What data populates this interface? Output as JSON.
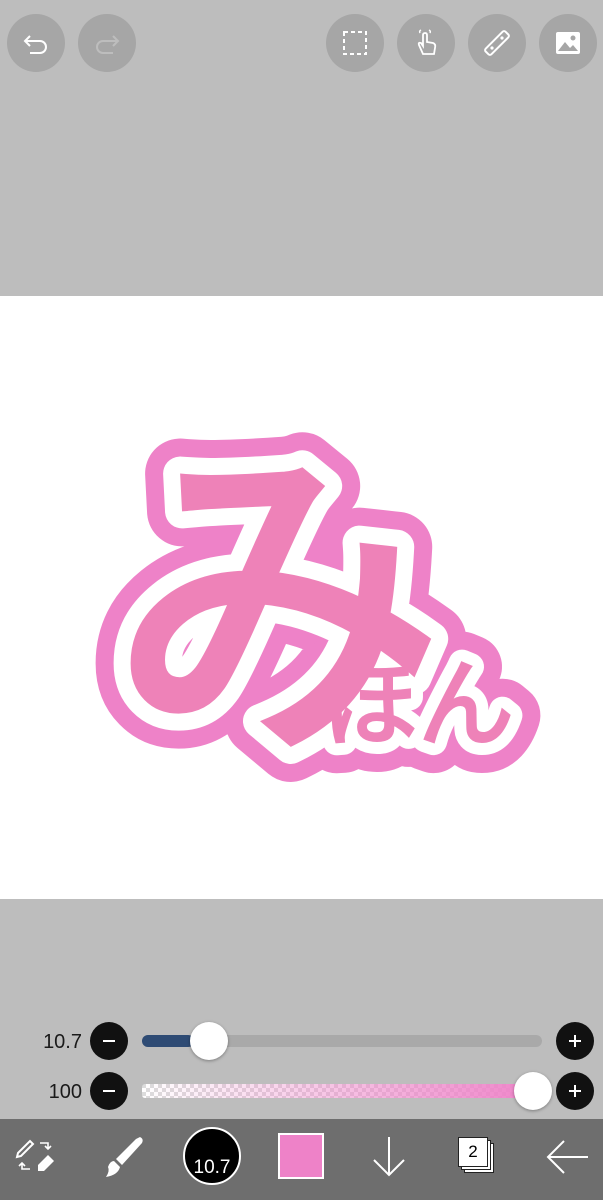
{
  "top_toolbar": {
    "undo_icon": "undo-arrow-icon",
    "redo_icon": "redo-arrow-icon",
    "selection_icon": "dashed-selection-icon",
    "hand_icon": "hand-tap-icon",
    "ruler_icon": "ruler-icon",
    "material_icon": "image-material-icon"
  },
  "canvas": {
    "artwork_text_large": "み",
    "artwork_text_small": "ほん",
    "fill_color": "#ee82b8",
    "outline_color": "#ee82c8"
  },
  "sliders": {
    "brush_size": {
      "value_label": "10.7",
      "level": 0.13
    },
    "opacity": {
      "value_label": "100",
      "level": 1.0
    }
  },
  "bottom_toolbar": {
    "brush_size_label": "10.7",
    "current_color": "#ee82c8",
    "layer_count": "2",
    "swap_tool_icon": "pen-eraser-swap-icon",
    "brush_icon": "brush-icon",
    "download_icon": "down-arrow-icon",
    "back_icon": "back-arrow-icon"
  },
  "colors": {
    "accent": "#2e4b74",
    "background": "#bdbdbd",
    "toolbar": "#6e6e6e"
  }
}
